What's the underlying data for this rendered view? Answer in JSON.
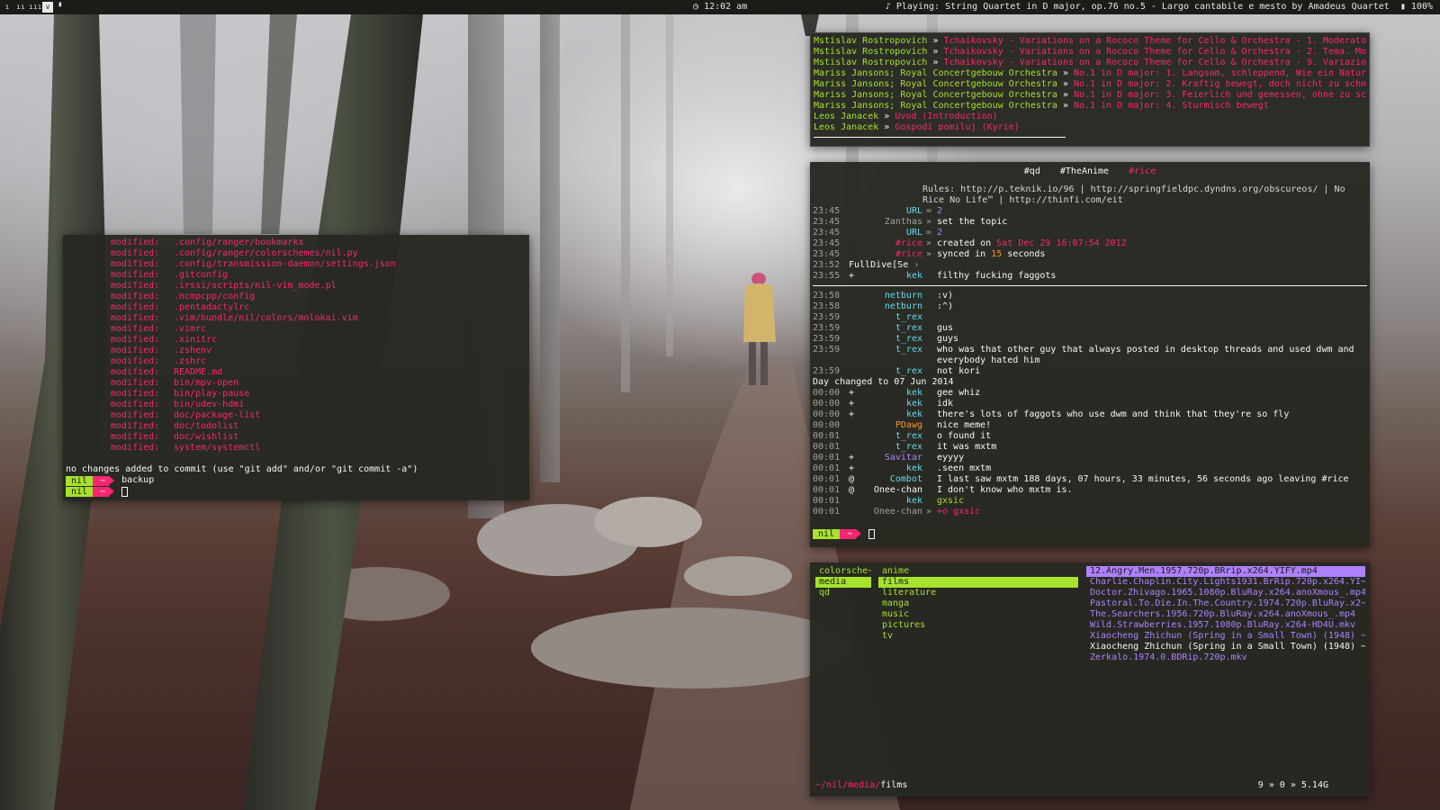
{
  "statusbar": {
    "workspaces": [
      "ı",
      "ıı",
      "ııı",
      "v",
      "▘"
    ],
    "clock_icon": "clock-icon",
    "clock": "12:02 am",
    "now_playing_prefix": "♪ Playing:",
    "now_playing": "String Quartet in D major, op.76 no.5 - Largo cantabile e mesto",
    "by": "by",
    "artist": "Amadeus Quartet",
    "battery": "100%"
  },
  "git": {
    "modified_label": "modified:",
    "files": [
      ".config/ranger/bookmarks",
      ".config/ranger/colorschemes/nil.py",
      ".config/transmission-daemon/settings.json",
      ".gitconfig",
      ".irssi/scripts/nil-vim_mode.pl",
      ".ncmpcpp/config",
      ".pentadactylrc",
      ".vim/bundle/nil/colors/molokai.vim",
      ".vimrc",
      ".xinitrc",
      ".zshenv",
      ".zshrc",
      "README.md",
      "bin/mpv-open",
      "bin/play-pause",
      "bin/udev-hdmi",
      "doc/package-list",
      "doc/todolist",
      "doc/wishlist",
      "system/systemctl"
    ],
    "summary": "no changes added to commit (use \"git add\" and/or \"git commit -a\")",
    "prompts": [
      {
        "user": "nil",
        "dir": "~",
        "text": "backup"
      },
      {
        "user": "nil",
        "dir": "~",
        "text": ""
      }
    ]
  },
  "playlist": [
    {
      "artist": "Mstislav Rostropovich",
      "title": "Tchaikovsky - Variations on a Rococo Theme for Cello & Orchestra - 1. Moderato"
    },
    {
      "artist": "Mstislav Rostropovich",
      "title": "Tchaikovsky - Variations on a Rococo Theme for Cello & Orchestra - 2. Tema. Mo"
    },
    {
      "artist": "Mstislav Rostropovich",
      "title": "Tchaikovsky - Variations on a Rococo Theme for Cello & Orchestra - 9. Variazio"
    },
    {
      "artist": "Mariss Jansons; Royal Concertgebouw Orchestra",
      "title": "No.1 in D major: 1. Langsam, schleppend, Wie ein Natur"
    },
    {
      "artist": "Mariss Jansons; Royal Concertgebouw Orchestra",
      "title": "No.1 in D major: 2. Kraftig bewegt, doch nicht zu schn"
    },
    {
      "artist": "Mariss Jansons; Royal Concertgebouw Orchestra",
      "title": "No.1 in D major: 3. Feierlich und gemessen, ohne zu sc"
    },
    {
      "artist": "Mariss Jansons; Royal Concertgebouw Orchestra",
      "title": "No.1 in D major: 4. Sturmisch bewegt"
    },
    {
      "artist": "Leos Janacek",
      "title": "Uvod (Introduction)"
    },
    {
      "artist": "Leos Janacek",
      "title": "Gospodi pomiluj (Kyrie)"
    }
  ],
  "irc": {
    "channels": [
      "#qd",
      "#TheAnime",
      "#rice"
    ],
    "topic": "Rules: http://p.teknik.io/96 | http://springfieldpc.dyndns.org/obscureos/ | No Rice No Life™ | http://thinfi.com/eit",
    "block1": [
      {
        "time": "23:45",
        "mode": "",
        "nick": "URL",
        "sep": "=",
        "msg": "2",
        "nc": "cyn",
        "mc": "pur"
      },
      {
        "time": "23:45",
        "mode": "",
        "nick": "Zanthas",
        "sep": "»",
        "msg": "set the topic",
        "nc": "gry",
        "mc": "wht"
      },
      {
        "time": "23:45",
        "mode": "",
        "nick": "URL",
        "sep": "=",
        "msg": "2",
        "nc": "cyn",
        "mc": "pur"
      },
      {
        "time": "23:45",
        "mode": "",
        "nick": "#rice",
        "sep": "»",
        "msg": "created on Sat Dec 29 16:07:54 2012",
        "nc": "mag",
        "mc": "wht"
      },
      {
        "time": "23:45",
        "mode": "",
        "nick": "#rice",
        "sep": "»",
        "msg": "synced in 15 seconds",
        "nc": "mag",
        "mc": "wht"
      }
    ],
    "fulldive": {
      "time": "23:52",
      "text": "FullDive[Se"
    },
    "kek1": {
      "time": "23:55",
      "mode": "+",
      "nick": "kek",
      "msg": "filthy fucking faggots"
    },
    "block2": [
      {
        "time": "23:58",
        "mode": "",
        "nick": "netburn",
        "msg": ":v)",
        "nc": "cyn"
      },
      {
        "time": "23:58",
        "mode": "",
        "nick": "netburn",
        "msg": ":^)",
        "nc": "cyn"
      },
      {
        "time": "23:59",
        "mode": "",
        "nick": "t_rex",
        "msg": "",
        "nc": "cyn"
      },
      {
        "time": "23:59",
        "mode": "",
        "nick": "t_rex",
        "msg": "gus",
        "nc": "cyn"
      },
      {
        "time": "23:59",
        "mode": "",
        "nick": "t_rex",
        "msg": "guys",
        "nc": "cyn"
      },
      {
        "time": "23:59",
        "mode": "",
        "nick": "t_rex",
        "msg": "who was that other guy that always posted in desktop threads and used dwm and everybody hated him",
        "nc": "cyn",
        "tall": true
      },
      {
        "time": "23:59",
        "mode": "",
        "nick": "t_rex",
        "msg": "not kori",
        "nc": "cyn"
      }
    ],
    "day_change": "Day changed to 07 Jun 2014",
    "block3": [
      {
        "time": "00:00",
        "mode": "+",
        "nick": "kek",
        "msg": "gee whiz",
        "nc": "cyn"
      },
      {
        "time": "00:00",
        "mode": "+",
        "nick": "kek",
        "msg": "idk",
        "nc": "cyn"
      },
      {
        "time": "00:00",
        "mode": "+",
        "nick": "kek",
        "msg": "there's lots of faggots who use dwm and think that they're so fly",
        "nc": "cyn"
      },
      {
        "time": "00:00",
        "mode": "",
        "nick": "PDawg",
        "msg": "nice meme!",
        "nc": "org"
      },
      {
        "time": "00:01",
        "mode": "",
        "nick": "t_rex",
        "msg": "o found it",
        "nc": "cyn"
      },
      {
        "time": "00:01",
        "mode": "",
        "nick": "t_rex",
        "msg": "it was mxtm",
        "nc": "cyn"
      },
      {
        "time": "00:01",
        "mode": "+",
        "nick": "Savitar",
        "msg": "eyyyy",
        "nc": "pur"
      },
      {
        "time": "00:01",
        "mode": "+",
        "nick": "kek",
        "msg": ".seen mxtm",
        "nc": "cyn"
      },
      {
        "time": "00:01",
        "mode": "@",
        "nick": "Combot",
        "msg": "I last saw mxtm 188 days, 07 hours, 33 minutes, 56 seconds ago leaving #rice",
        "nc": "cyn"
      },
      {
        "time": "00:01",
        "mode": "@",
        "nick": "Onee-chan",
        "msg": "I don't know who mxtm is.",
        "nc": "wht"
      },
      {
        "time": "00:01",
        "mode": "",
        "nick": "kek",
        "msg": "gxsic",
        "nc": "cyn",
        "mcol": "grn"
      },
      {
        "time": "00:01",
        "mode": "",
        "nick": "Onee-chan",
        "sep": "»",
        "msg": "+o gxsic",
        "nc": "gry",
        "mcol": "mag"
      }
    ],
    "prompt": {
      "user": "nil",
      "dir": "~"
    }
  },
  "ranger": {
    "col1": [
      "colorsche~",
      "media",
      "qd"
    ],
    "col1_selected": 1,
    "col2": [
      "anime",
      "films",
      "literature",
      "manga",
      "music",
      "pictures",
      "tv"
    ],
    "col2_selected": 1,
    "col3": [
      "12.Angry.Men.1957.720p.BRrip.x264.YIFY.mp4",
      "Charlie.Chaplin.City.Lights1931.BrRip.720p.x264.YI~",
      "Doctor.Zhivago.1965.1080p.BluRay.x264.anoXmous_.mp4",
      "Pastoral.To.Die.In.The.Country.1974.720p.BluRay.x2~",
      "The.Searchers.1956.720p.BluRay.x264.anoXmous_.mp4",
      "Wild.Strawberries.1957.1080p.BluRay.x264-HD4U.mkv",
      "Xiaocheng Zhichun (Spring in a Small Town) (1948) ~",
      "Xiaocheng Zhichun (Spring in a Small Town) (1948) ~",
      "Zerkalo.1974.0.BDRip.720p.mkv"
    ],
    "col3_selected": 0,
    "path_prefix": "~/nil/media/",
    "path_current": "films",
    "status": "9 » 0 » 5.14G"
  }
}
